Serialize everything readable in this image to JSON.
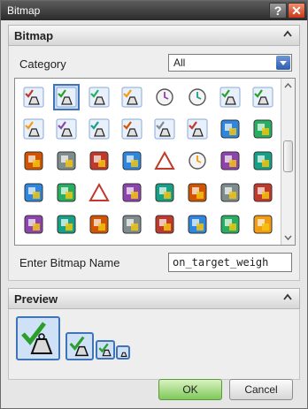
{
  "window": {
    "title": "Bitmap",
    "help_icon": "help-icon",
    "close_icon": "close-icon"
  },
  "bitmap_section": {
    "header": "Bitmap",
    "category_label": "Category",
    "category_value": "All",
    "name_label": "Enter Bitmap Name",
    "name_value": "on_target_weigh"
  },
  "icon_grid": {
    "rows": [
      [
        "letter-b-weight-icon",
        "check-weight-icon",
        "plus-weight-icon",
        "minus-weight-icon",
        "clock-icon",
        "color-clock-icon",
        "checkered-flag-icon",
        "check-clock-icon",
        "scroll-up-arrow"
      ],
      [
        "red-ball-weight-icon",
        "question-weight-icon",
        "clock-weight-icon",
        "red-box-weight-icon",
        "magnifier-weight-icon",
        "box-weight-icon",
        "person-box-icon",
        "person-card-icon"
      ],
      [
        "person-portrait-icon",
        "flag-person-icon",
        "globe-icon",
        "house-icon",
        "red-triangle-icon",
        "clock-triangle-icon",
        "red-boxes-icon",
        "dark-boxes-icon"
      ],
      [
        "green-blocks-icon",
        "blue-boxes-icon",
        "red-triangle-box-icon",
        "magnifier-box-icon",
        "gear-boxes-icon",
        "yellow-boxes-icon",
        "orange-boxes-icon",
        "gear-yellow-icon"
      ],
      [
        "document-grid-icon",
        "document-red-icon",
        "layers-icon",
        "boxes-stack-icon",
        "boxes-arrow-icon",
        "open-box-icon",
        "blue-box-icon",
        "box-orange-icon"
      ]
    ],
    "selected_index": 1
  },
  "preview_section": {
    "header": "Preview",
    "icon": "check-weight-icon"
  },
  "buttons": {
    "ok": "OK",
    "cancel": "Cancel"
  }
}
